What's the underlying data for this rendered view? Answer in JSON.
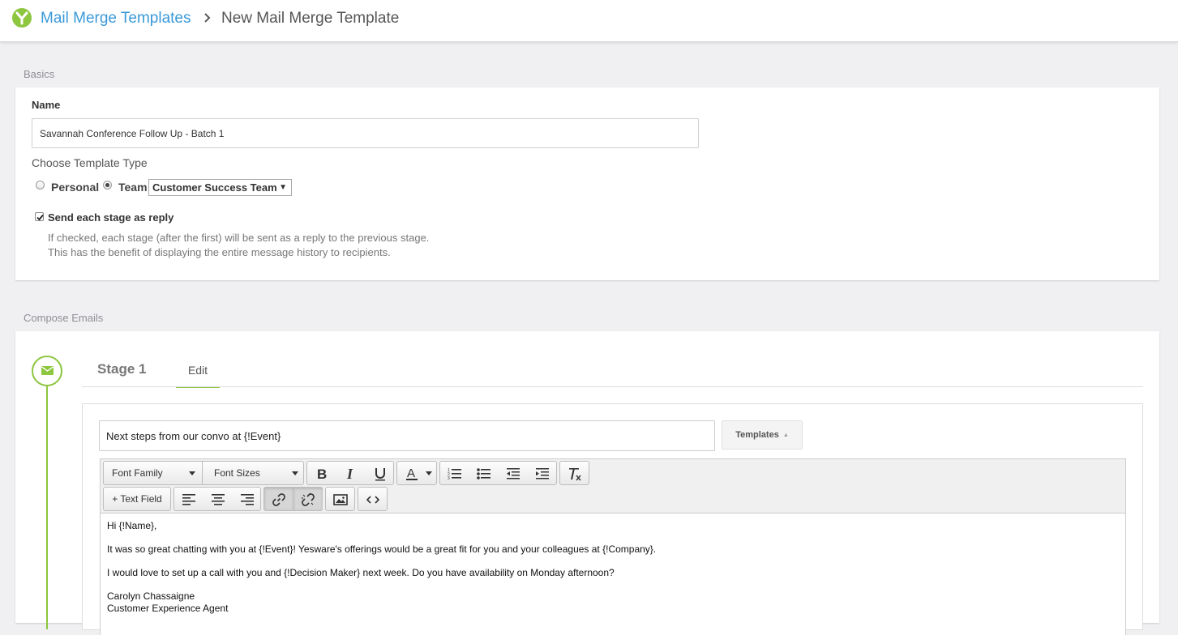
{
  "header": {
    "breadcrumb_link": "Mail Merge Templates",
    "breadcrumb_current": "New Mail Merge Template",
    "logo_icon": "yesware-logo-icon",
    "brand_color": "#8dc63f",
    "link_color": "#3a9ad9"
  },
  "basics": {
    "section_label": "Basics",
    "name_label": "Name",
    "name_value": "Savannah Conference Follow Up - Batch 1",
    "template_type_label": "Choose Template Type",
    "personal_label": "Personal",
    "team_label": "Team",
    "selected_type": "Team",
    "team_select_value": "Customer Success Team",
    "reply_checkbox_label": "Send each stage as reply",
    "reply_checked": true,
    "help_line_1": "If checked, each stage (after the first) will be sent as a reply to the previous stage.",
    "help_line_2": "This has the benefit of displaying the entire message history to recipients."
  },
  "compose": {
    "section_label": "Compose Emails",
    "stage_title": "Stage 1",
    "edit_tab": "Edit",
    "subject_value": "Next steps from our convo at {!Event}",
    "templates_button": "Templates",
    "toolbar": {
      "font_family": "Font Family",
      "font_sizes": "Font Sizes",
      "text_field_button": "+ Text Field",
      "buttons": [
        "bold-icon",
        "italic-icon",
        "underline-icon",
        "text-color-icon",
        "numbered-list-icon",
        "bulleted-list-icon",
        "outdent-icon",
        "indent-icon",
        "clear-formatting-icon",
        "align-left-icon",
        "align-center-icon",
        "align-right-icon",
        "link-icon",
        "unlink-icon",
        "image-icon",
        "source-code-icon"
      ]
    },
    "body": {
      "greeting": "Hi {!Name},",
      "para_1": "It was so great chatting with you at {!Event}!  Yesware's offerings would be a great fit for you and your colleagues at {!Company}.",
      "para_2": "I would love to set up a call with you and {!Decision Maker} next week.  Do you have availability on Monday afternoon?",
      "signature_name": "Carolyn Chassaigne",
      "signature_title": "Customer Experience Agent"
    }
  }
}
